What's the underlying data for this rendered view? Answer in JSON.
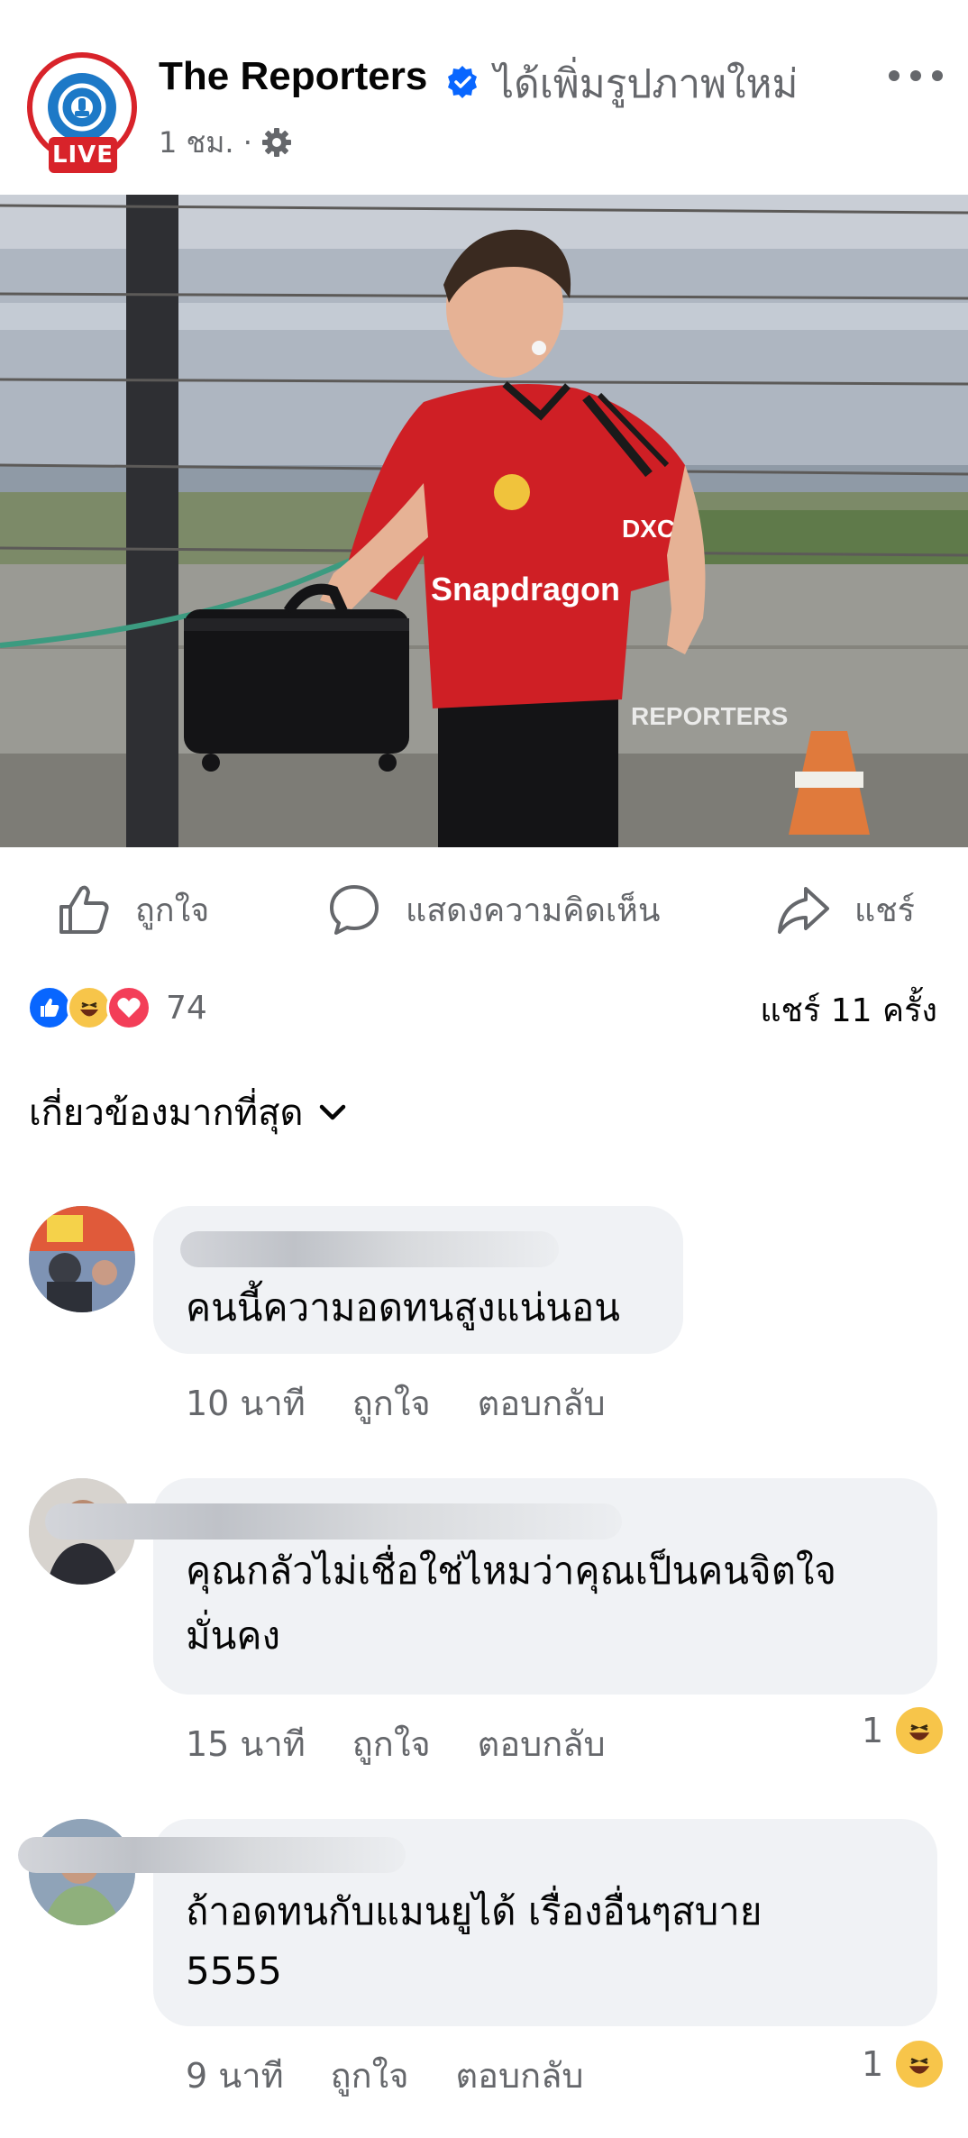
{
  "post": {
    "page_name": "The Reporters",
    "action": "ได้เพิ่มรูปภาพใหม่",
    "time": "1 ชม. ·",
    "avatar_badge": "LIVE",
    "photo_watermark": "REPORTERS",
    "icons": {
      "verified": "verified-badge-icon",
      "privacy": "gear-icon",
      "more": "more-options-icon"
    }
  },
  "actions": {
    "like": "ถูกใจ",
    "comment": "แสดงความคิดเห็น",
    "share": "แชร์"
  },
  "summary": {
    "reaction_count": "74",
    "shares": "แชร์ 11 ครั้ง",
    "reactions": [
      "like",
      "haha",
      "love"
    ]
  },
  "sort": {
    "label": "เกี่ยวข้องมากที่สุด"
  },
  "comments": [
    {
      "text": "คนนี้ความอดทนสูงแน่นอน",
      "time": "10 นาที",
      "like": "ถูกใจ",
      "reply": "ตอบกลับ",
      "reaction_count": ""
    },
    {
      "text_line1": "คุณกลัวไม่เชื่อใช่ไหมว่าคุณเป็นคนจิตใจ",
      "text_line2": "มั่นคง",
      "time": "15 นาที",
      "like": "ถูกใจ",
      "reply": "ตอบกลับ",
      "reaction_count": "1"
    },
    {
      "text_line1": "ถ้าอดทนกับแมนยูได้ เรื่องอื่นๆสบาย",
      "text_line2": "5555",
      "time": "9 นาที",
      "like": "ถูกใจ",
      "reply": "ตอบกลับ",
      "reaction_count": "1"
    }
  ],
  "colors": {
    "accent": "#0866ff",
    "brand_red": "#d8232a",
    "muted": "#65676b",
    "bubble": "#f0f2f5"
  }
}
